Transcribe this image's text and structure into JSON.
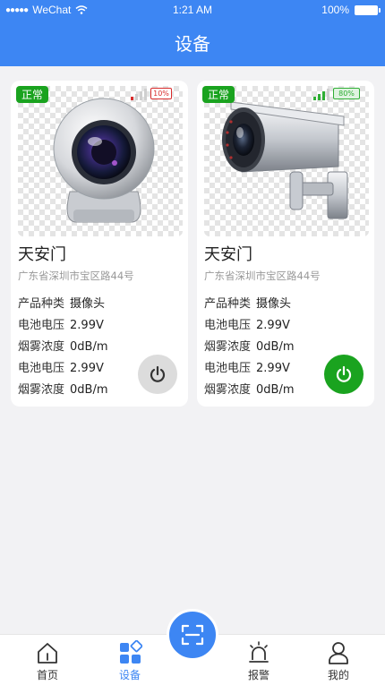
{
  "status_bar": {
    "carrier": "WeChat",
    "time": "1:21 AM",
    "battery": "100%"
  },
  "header": {
    "title": "设备"
  },
  "devices": [
    {
      "status": "正常",
      "battery_level": "10%",
      "battery_color": "#d92b2b",
      "name": "天安门",
      "address": "广东省深圳市宝区路44号",
      "fields": [
        {
          "label": "产品种类",
          "value": "摄像头"
        },
        {
          "label": "电池电压",
          "value": "2.99V"
        },
        {
          "label": "烟雾浓度",
          "value": "0dB/m"
        },
        {
          "label": "电池电压",
          "value": "2.99V"
        },
        {
          "label": "烟雾浓度",
          "value": "0dB/m"
        }
      ],
      "power_state": "off",
      "image_icon": "webcam-icon"
    },
    {
      "status": "正常",
      "battery_level": "80%",
      "battery_color": "#2fae34",
      "name": "天安门",
      "address": "广东省深圳市宝区路44号",
      "fields": [
        {
          "label": "产品种类",
          "value": "摄像头"
        },
        {
          "label": "电池电压",
          "value": "2.99V"
        },
        {
          "label": "烟雾浓度",
          "value": "0dB/m"
        },
        {
          "label": "电池电压",
          "value": "2.99V"
        },
        {
          "label": "烟雾浓度",
          "value": "0dB/m"
        }
      ],
      "power_state": "on",
      "image_icon": "bullet-camera-icon"
    }
  ],
  "tabs": [
    {
      "label": "首页",
      "icon": "home-icon",
      "active": false
    },
    {
      "label": "设备",
      "icon": "devices-grid-icon",
      "active": true
    },
    {
      "label": "报警",
      "icon": "alarm-icon",
      "active": false
    },
    {
      "label": "我的",
      "icon": "user-icon",
      "active": false
    }
  ],
  "scan_button": {
    "icon": "scan-icon"
  },
  "colors": {
    "primary": "#3d86f3",
    "status_ok": "#1aa31f",
    "power_on": "#1aa31f",
    "power_off": "#dcdcdc"
  }
}
